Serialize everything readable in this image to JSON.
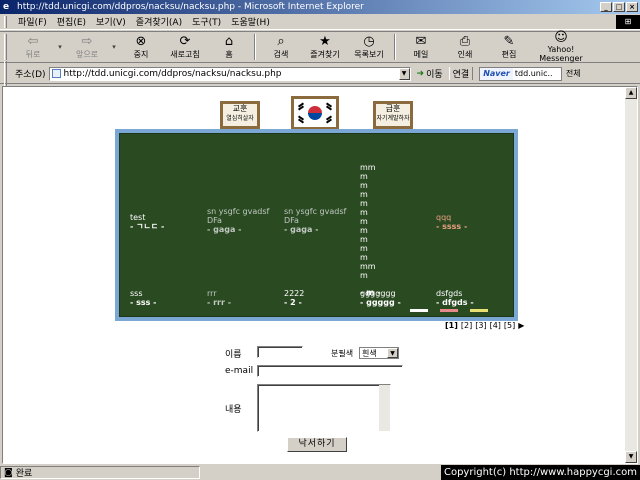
{
  "window": {
    "title": "http://tdd.unicgi.com/ddpros/nacksu/nacksu.php - Microsoft Internet Explorer",
    "minimize": "_",
    "maximize": "□",
    "close": "×"
  },
  "menu": {
    "items": [
      "파일(F)",
      "편집(E)",
      "보기(V)",
      "즐겨찾기(A)",
      "도구(T)",
      "도움말(H)"
    ]
  },
  "toolbar": {
    "back": "뒤로",
    "forward": "앞으로",
    "stop": "중지",
    "refresh": "새로고침",
    "home": "홈",
    "search": "검색",
    "favorites": "즐겨찾기",
    "history": "목록보기",
    "mail": "메일",
    "print": "인쇄",
    "edit": "편집",
    "yahoo": "Yahoo! Messenger"
  },
  "address": {
    "label": "주소(D)",
    "url": "http://tdd.unicgi.com/ddpros/nacksu/nacksu.php",
    "go": "이동",
    "links": "연결",
    "naver_logo": "Naver",
    "naver_input": "tdd.unic..",
    "naver_all": "전체"
  },
  "page": {
    "sign_left": {
      "title": "교훈",
      "sub": "열심히살자"
    },
    "sign_right": {
      "title": "급훈",
      "sub": "자기계발하자"
    },
    "notes": [
      {
        "text": "test",
        "who": "- ㄱㄴㄷ -",
        "color": "#ffffff"
      },
      {
        "text": "sn ysgfc gvadsf\nDFa",
        "who": "- gaga -",
        "color": "#c0c8c0"
      },
      {
        "text": "sn ysgfc gvadsf\nDFa",
        "who": "- gaga -",
        "color": "#c0c8c0"
      },
      {
        "text": "mm\nm\nm\nm\nm\nm\nm\nm\nm\nm\nm\nmm\nm",
        "who": "- m -",
        "color": "#ffffff"
      },
      {
        "text": "qqq",
        "who": "- ssss -",
        "color": "#e8a080"
      },
      {
        "text": "sss",
        "who": "- sss -",
        "color": "#ffffff"
      },
      {
        "text": "rrr",
        "who": "- rrr -",
        "color": "#c0c8c0"
      },
      {
        "text": "2222",
        "who": "- 2 -",
        "color": "#ffffff"
      },
      {
        "text": "ggggggg",
        "who": "- ggggg -",
        "color": "#ffffff"
      },
      {
        "text": "dsfgds",
        "who": "- dfgds -",
        "color": "#ffffff"
      }
    ],
    "chalk_colors": [
      "#ffffff",
      "#e88a8a",
      "#e8e070"
    ],
    "pager": {
      "pages": [
        "[1]",
        "[2]",
        "[3]",
        "[4]",
        "[5]"
      ],
      "current": "[1]",
      "next": "▶"
    },
    "form": {
      "name_label": "이름",
      "name_value": "",
      "color_label": "분필색",
      "color_value": "흰색",
      "email_label": "e-mail",
      "email_value": "",
      "content_label": "내용",
      "content_value": "",
      "submit": "낙서하기"
    }
  },
  "status": {
    "text": "완료",
    "copyright": "Copyright(c) http://www.happycgi.com"
  }
}
